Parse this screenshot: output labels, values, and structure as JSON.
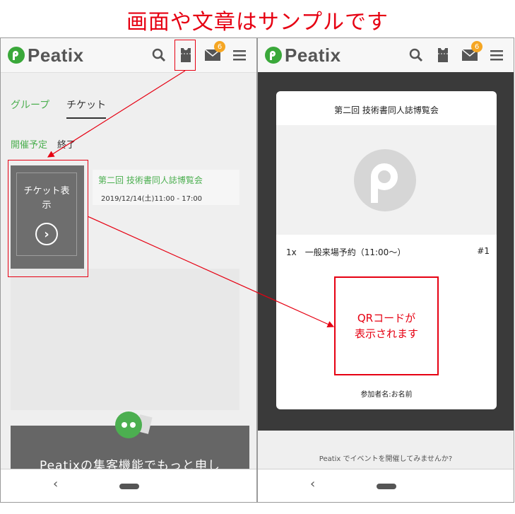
{
  "caption": "画面や文章はサンプルです",
  "app": {
    "logo_text": "Peatix",
    "message_badge": "6",
    "icons": [
      "search-icon",
      "ticket-icon",
      "mail-icon",
      "menu-icon"
    ]
  },
  "left": {
    "tabs": [
      {
        "label": "グループ"
      },
      {
        "label": "チケット"
      }
    ],
    "subtabs": [
      {
        "label": "開催予定"
      },
      {
        "label": "終了"
      }
    ],
    "ticket_card": {
      "label": "チケット表示"
    },
    "event": {
      "title": "第二回 技術書同人誌博覧会",
      "date": "2019/12/14(土)11:00 - 17:00"
    },
    "promo": {
      "text": "Peatixの集客機能でもっと申し"
    }
  },
  "right": {
    "event_title": "第二回 技術書同人誌博覧会",
    "ticket_type": "1x　一般来場予約（11:00〜）",
    "ticket_number": "#1",
    "qr_placeholder": "QRコードが\n表示されます",
    "attendee": "参加者名:お名前",
    "host_cta": "Peatix でイベントを開催してみませんか?"
  },
  "nav": {
    "back_symbol": "‹"
  },
  "colors": {
    "accent": "#4caf50",
    "annotation": "#e60012",
    "badge": "#f5a623",
    "card": "#6e6e6e"
  }
}
